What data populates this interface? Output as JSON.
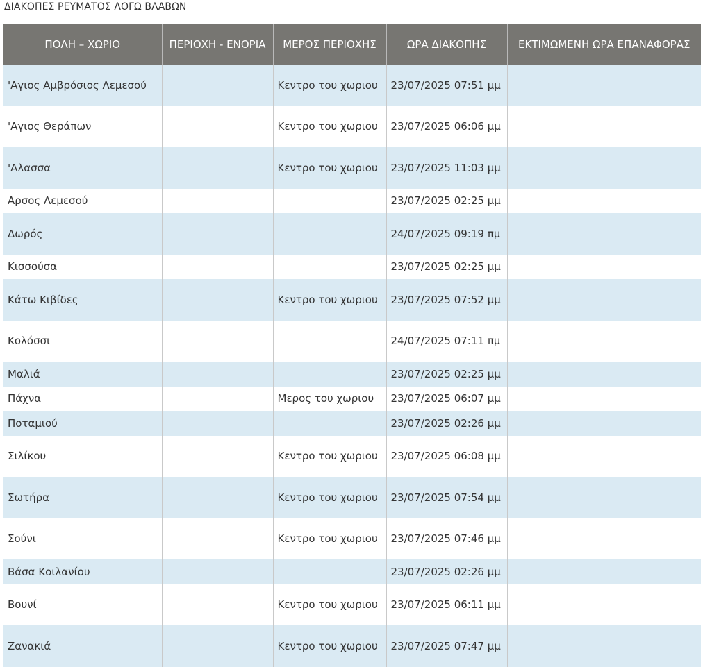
{
  "page": {
    "title": "ΔΙΑΚΟΠΕΣ ΡΕΥΜΑΤΟΣ ΛΟΓΩ ΒΛΑΒΩΝ"
  },
  "table": {
    "headers": [
      "ΠΟΛΗ – ΧΩΡΙΟ",
      "ΠΕΡΙΟΧΗ - ΕΝΟΡΙΑ",
      "ΜΕΡΟΣ ΠΕΡΙΟΧΗΣ",
      "ΩΡΑ ΔΙΑΚΟΠΗΣ",
      "ΕΚΤΙΜΩΜΕΝΗ ΩΡΑ ΕΠΑΝΑΦΟΡΑΣ"
    ],
    "rows": [
      {
        "village": "'Αγιος Αμβρόσιος Λεμεσού",
        "parish": "",
        "area_part": "Κεντρο του χωριου",
        "outage_time": "23/07/2025 07:51 μμ",
        "restore_time": ""
      },
      {
        "village": "'Αγιος Θεράπων",
        "parish": "",
        "area_part": "Κεντρο του χωριου",
        "outage_time": "23/07/2025 06:06 μμ",
        "restore_time": ""
      },
      {
        "village": "'Αλασσα",
        "parish": "",
        "area_part": "Κεντρο του χωριου",
        "outage_time": "23/07/2025 11:03 μμ",
        "restore_time": ""
      },
      {
        "village": "Αρσος Λεμεσού",
        "parish": "",
        "area_part": "",
        "outage_time": "23/07/2025 02:25 μμ",
        "restore_time": ""
      },
      {
        "village": "Δωρός",
        "parish": "",
        "area_part": "",
        "outage_time": "24/07/2025 09:19 πμ",
        "restore_time": ""
      },
      {
        "village": "Κισσούσα",
        "parish": "",
        "area_part": "",
        "outage_time": "23/07/2025 02:25 μμ",
        "restore_time": ""
      },
      {
        "village": "Κάτω Κιβίδες",
        "parish": "",
        "area_part": "Κεντρο του χωριου",
        "outage_time": "23/07/2025 07:52 μμ",
        "restore_time": ""
      },
      {
        "village": "Κολόσσι",
        "parish": "",
        "area_part": "",
        "outage_time": "24/07/2025 07:11 πμ",
        "restore_time": ""
      },
      {
        "village": "Μαλιά",
        "parish": "",
        "area_part": "",
        "outage_time": "23/07/2025 02:25 μμ",
        "restore_time": ""
      },
      {
        "village": "Πάχνα",
        "parish": "",
        "area_part": "Μερος του χωριου",
        "outage_time": "23/07/2025 06:07 μμ",
        "restore_time": ""
      },
      {
        "village": "Ποταμιού",
        "parish": "",
        "area_part": "",
        "outage_time": "23/07/2025 02:26 μμ",
        "restore_time": ""
      },
      {
        "village": "Σιλίκου",
        "parish": "",
        "area_part": "Κεντρο του χωριου",
        "outage_time": "23/07/2025 06:08 μμ",
        "restore_time": ""
      },
      {
        "village": "Σωτήρα",
        "parish": "",
        "area_part": "Κεντρο του χωριου",
        "outage_time": "23/07/2025 07:54 μμ",
        "restore_time": ""
      },
      {
        "village": "Σούνι",
        "parish": "",
        "area_part": "Κεντρο του χωριου",
        "outage_time": "23/07/2025 07:46 μμ",
        "restore_time": ""
      },
      {
        "village": "Βάσα Κοιλανίου",
        "parish": "",
        "area_part": "",
        "outage_time": "23/07/2025 02:26 μμ",
        "restore_time": ""
      },
      {
        "village": "Βουνί",
        "parish": "",
        "area_part": "Κεντρο του χωριου",
        "outage_time": "23/07/2025 06:11 μμ",
        "restore_time": ""
      },
      {
        "village": "Ζανακιά",
        "parish": "",
        "area_part": "Κεντρο του χωριου",
        "outage_time": "23/07/2025 07:47 μμ",
        "restore_time": ""
      }
    ]
  },
  "colors": {
    "header_bg": "#777672",
    "header_text": "#ffffff",
    "row_alt_bg": "#daeaf3",
    "row_plain_bg": "#ffffff",
    "text": "#333333"
  }
}
